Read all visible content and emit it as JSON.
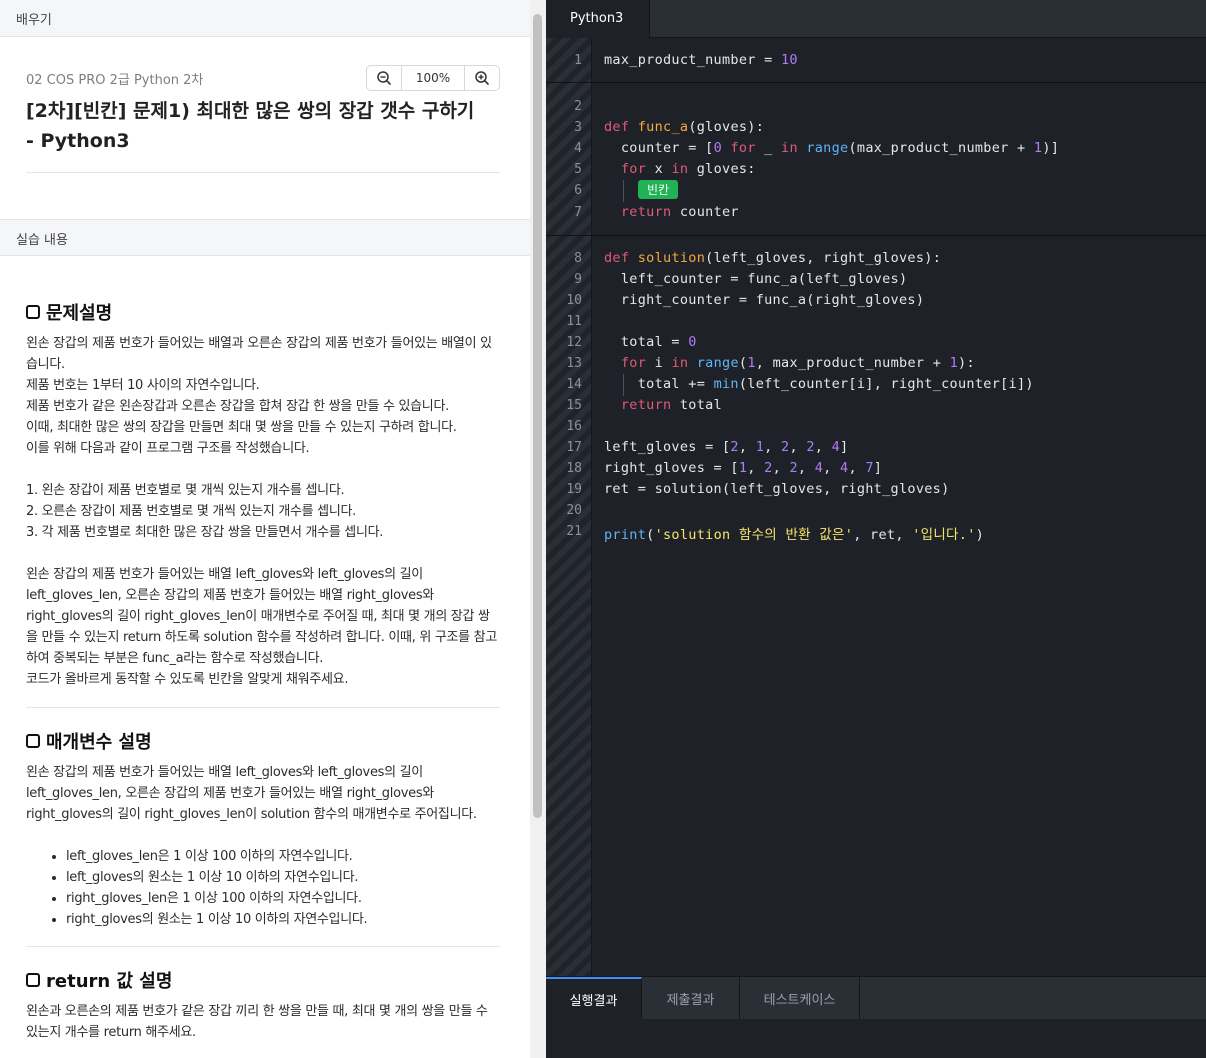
{
  "left": {
    "learn_bar": "배우기",
    "practice_bar": "실습 내용",
    "breadcrumb": "02 COS PRO 2급 Python 2차",
    "zoom": {
      "value": "100%",
      "zoom_out_icon": "magnifier-minus-icon",
      "zoom_in_icon": "magnifier-plus-icon"
    },
    "title": "[2차][빈칸] 문제1) 최대한 많은 쌍의 장갑 갯수 구하기 - Python3",
    "sections": {
      "problem": {
        "heading": "문제설명",
        "lines": [
          "왼손 장갑의 제품 번호가 들어있는 배열과 오른손 장갑의 제품 번호가 들어있는 배열이 있",
          "습니다.",
          "제품 번호는 1부터 10 사이의 자연수입니다.",
          "제품 번호가 같은 왼손장갑과 오른손 장갑을 합쳐 장갑 한 쌍을 만들 수 있습니다.",
          "이때, 최대한 많은 쌍의 장갑을 만들면 최대 몇 쌍을 만들 수 있는지 구하려 합니다.",
          "이를 위해 다음과 같이 프로그램 구조를 작성했습니다.",
          "",
          "1. 왼손 장갑이 제품 번호별로 몇 개씩 있는지 개수를 셉니다.",
          "2. 오른손 장갑이 제품 번호별로 몇 개씩 있는지 개수를 셉니다.",
          "3. 각 제품 번호별로 최대한 많은 장갑 쌍을 만들면서 개수를 셉니다.",
          "",
          "왼손 장갑의 제품 번호가 들어있는 배열 left_gloves와 left_gloves의 길이",
          "left_gloves_len, 오른손 장갑의 제품 번호가 들어있는 배열 right_gloves와",
          "right_gloves의 길이 right_gloves_len이 매개변수로 주어질 때, 최대 몇 개의 장갑 쌍",
          "을 만들 수 있는지 return 하도록 solution 함수를 작성하려 합니다. 이때, 위 구조를 참고",
          "하여 중복되는 부분은 func_a라는 함수로 작성했습니다.",
          "코드가 올바르게 동작할 수 있도록 빈칸을 알맞게 채워주세요."
        ]
      },
      "params": {
        "heading": "매개변수 설명",
        "lines": [
          "왼손 장갑의 제품 번호가 들어있는 배열 left_gloves와 left_gloves의 길이",
          "left_gloves_len, 오른손 장갑의 제품 번호가 들어있는 배열 right_gloves와",
          "right_gloves의 길이 right_gloves_len이 solution 함수의 매개변수로 주어집니다."
        ],
        "bullets": [
          "left_gloves_len은 1 이상 100 이하의 자연수입니다.",
          "left_gloves의 원소는 1 이상 10 이하의 자연수입니다.",
          "right_gloves_len은 1 이상 100 이하의 자연수입니다.",
          "right_gloves의 원소는 1 이상 10 이하의 자연수입니다."
        ]
      },
      "return": {
        "heading": "return 값 설명",
        "lines": [
          "왼손과 오른손의 제품 번호가 같은 장갑 끼리 한 쌍을 만들 때, 최대 몇 개의 쌍을 만들 수",
          "있는지 개수를 return 해주세요."
        ]
      }
    }
  },
  "editor": {
    "tab": "Python3",
    "blank_label": "빈칸",
    "line_numbers": [
      "1",
      "2",
      "3",
      "4",
      "5",
      "6",
      "7",
      "8",
      "9",
      "10",
      "11",
      "12",
      "13",
      "14",
      "15",
      "16",
      "17",
      "18",
      "19",
      "20",
      "21"
    ],
    "bottom_tabs": [
      "실행결과",
      "제출결과",
      "테스트케이스"
    ],
    "active_bottom_tab": "실행결과",
    "colors": {
      "keyword": "#e05a7a",
      "function": "#f5a742",
      "number": "#b07cf6",
      "builtin": "#5fb4f5",
      "string": "#f5e66a",
      "blank": "#1fb356",
      "active_tab": "#3a8ef6"
    }
  }
}
